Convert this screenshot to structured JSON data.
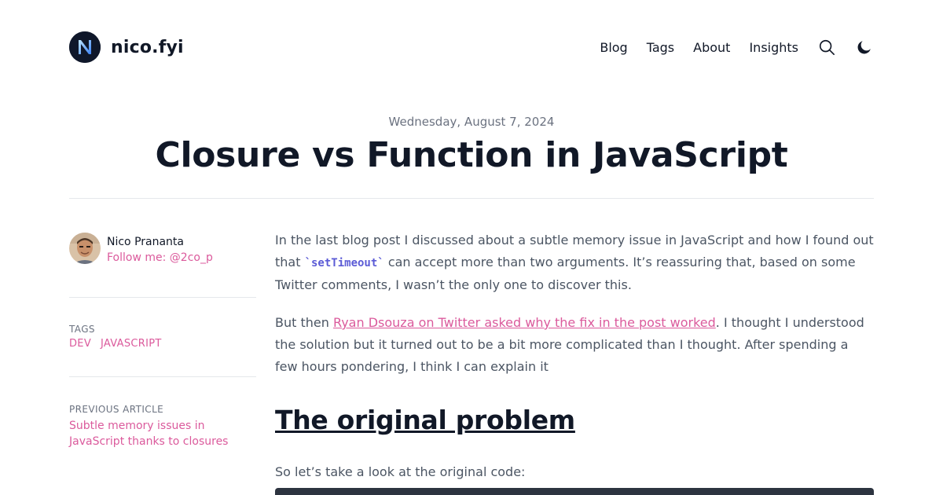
{
  "header": {
    "logo_text": "nico.fyi",
    "nav": [
      {
        "label": "Blog"
      },
      {
        "label": "Tags"
      },
      {
        "label": "About"
      },
      {
        "label": "Insights"
      }
    ]
  },
  "post": {
    "date": "Wednesday, August 7, 2024",
    "title": "Closure vs Function in JavaScript"
  },
  "author": {
    "name": "Nico Prananta",
    "follow": "Follow me: @2co_p"
  },
  "tags": {
    "label": "TAGS",
    "items": [
      "DEV",
      "JAVASCRIPT"
    ]
  },
  "previous": {
    "label": "PREVIOUS ARTICLE",
    "title": "Subtle memory issues in JavaScript thanks to closures"
  },
  "content": {
    "p1_before": "In the last blog post I discussed about a subtle memory issue in JavaScript and how I found out that ",
    "p1_code": "`setTimeout`",
    "p1_after": " can accept more than two arguments. It’s reassuring that, based on some Twitter comments, I wasn’t the only one to discover this.",
    "p2_before": "But then ",
    "p2_link": "Ryan Dsouza on Twitter asked why the fix in the post worked",
    "p2_after": ". I thought I understood the solution but it turned out to be a bit more complicated than I thought. After spending a few hours pondering, I think I can explain it",
    "heading": "The original problem",
    "p3": "So let’s take a look at the original code:"
  },
  "colors": {
    "accent": "#db5a9c",
    "code": "#5b5bd6",
    "text": "#111827",
    "muted": "#6b7280",
    "code_bg": "#2d3440"
  },
  "icons": {
    "logo": "n-logo-icon",
    "search": "search-icon",
    "theme": "moon-icon"
  }
}
